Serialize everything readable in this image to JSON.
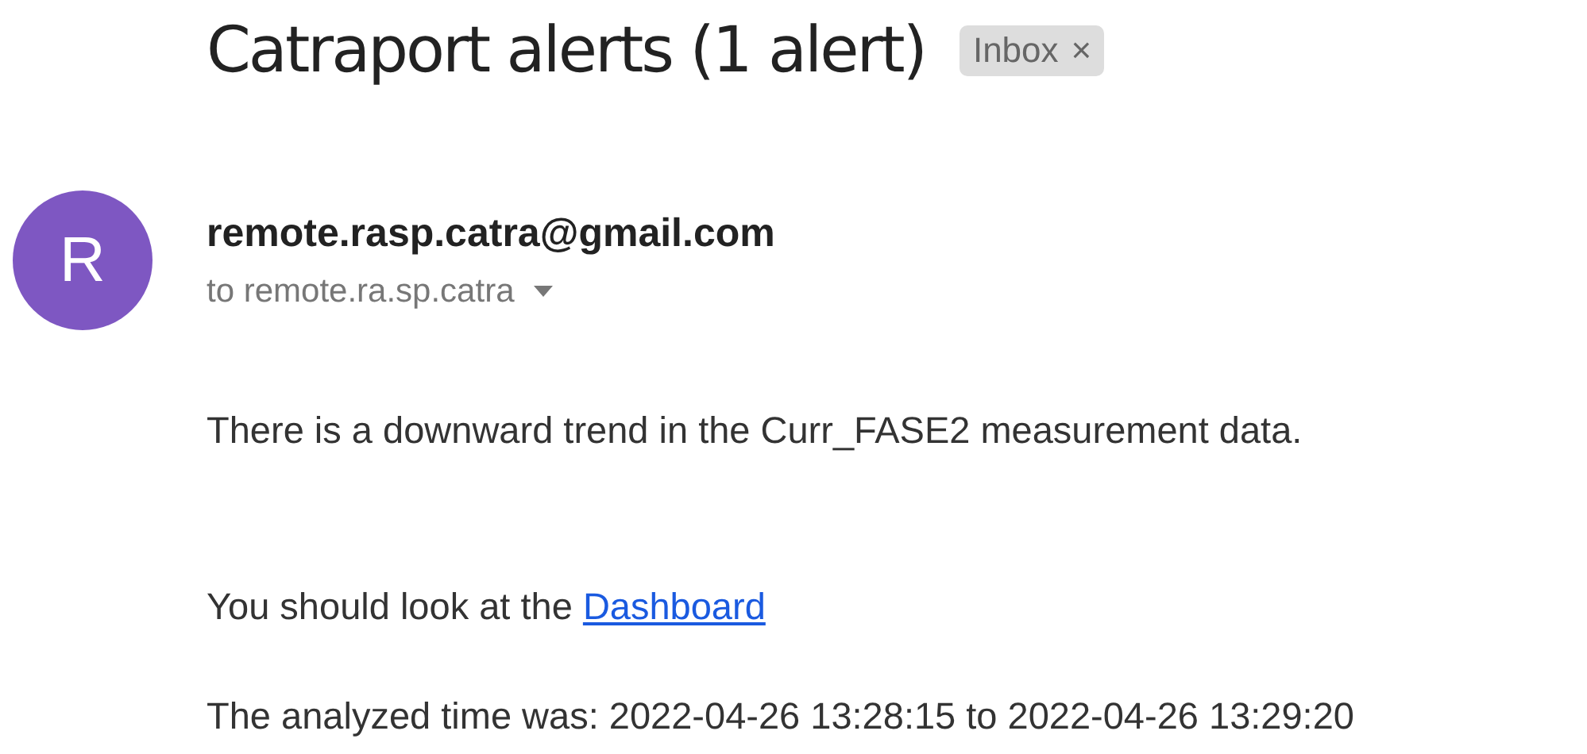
{
  "subject": "Catraport alerts (1 alert)",
  "label_chip": {
    "text": "Inbox",
    "remove": "×"
  },
  "sender": {
    "avatar_letter": "R",
    "email": "remote.rasp.catra@gmail.com",
    "recipient": "to remote.ra.sp.catra"
  },
  "body": {
    "line_1": "There is a downward trend in the Curr_FASE2 measurement data.",
    "line_2_text": "You should look at the ",
    "line_2_link": "Dashboard",
    "line_3": "The analyzed time was: 2022-04-26 13:28:15 to 2022-04-26 13:29:20"
  }
}
